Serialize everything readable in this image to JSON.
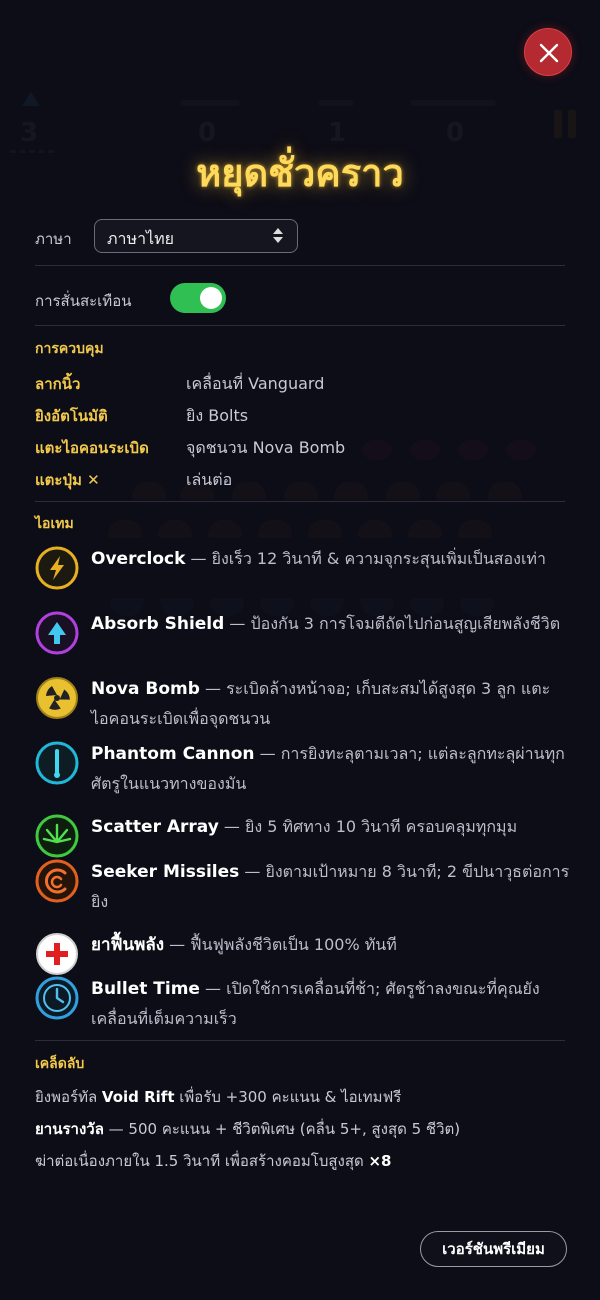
{
  "title": "หยุดชั่วคราว",
  "background_hud": {
    "lives": "3",
    "score_a": "0",
    "score_b": "1",
    "score_c": "0"
  },
  "settings": {
    "language_label": "ภาษา",
    "language_value": "ภาษาไทย",
    "vibration_label": "การสั่นสะเทือน",
    "vibration_on": true
  },
  "controls": {
    "heading": "การควบคุม",
    "rows": [
      {
        "key": "ลากนิ้ว",
        "value": "เคลื่อนที่ Vanguard"
      },
      {
        "key": "ยิงอัตโนมัติ",
        "value": "ยิง Bolts"
      },
      {
        "key": "แตะไอคอนระเบิด",
        "value": "จุดชนวน Nova Bomb"
      },
      {
        "key": "แตะปุ่ม ✕",
        "value": "เล่นต่อ"
      }
    ]
  },
  "items": {
    "heading": "ไอเทม",
    "list": [
      {
        "name": "Overclock",
        "desc": " — ยิงเร็ว 12 วินาที & ความจุกระสุนเพิ่มเป็นสองเท่า",
        "icon": "lightning-icon",
        "color": "#e8b020"
      },
      {
        "name": "Absorb Shield",
        "desc": " — ป้องกัน 3 การโจมตีถัดไปก่อนสูญเสียพลังชีวิต",
        "icon": "shield-arrow-icon",
        "color": "#b040e0"
      },
      {
        "name": "Nova Bomb",
        "desc": " — ระเบิดล้างหน้าจอ; เก็บสะสมได้สูงสุด 3 ลูก แตะไอคอนระเบิดเพื่อจุดชนวน",
        "icon": "radiation-icon",
        "color": "#e8c030"
      },
      {
        "name": "Phantom Cannon",
        "desc": " — การยิงทะลุตามเวลา; แต่ละลูกทะลุผ่านทุกศัตรูในแนวทางของมัน",
        "icon": "beam-icon",
        "color": "#20b8d8"
      },
      {
        "name": "Scatter Array",
        "desc": " — ยิง 5 ทิศทาง 10 วินาที ครอบคลุมทุกมุม",
        "icon": "spread-icon",
        "color": "#40c840"
      },
      {
        "name": "Seeker Missiles",
        "desc": " — ยิงตามเป้าหมาย 8 วินาที; 2 ขีปนาวุธต่อการยิง",
        "icon": "homing-icon",
        "color": "#e06020"
      },
      {
        "name": "ยาฟื้นพลัง",
        "desc": " — ฟื้นฟูพลังชีวิตเป็น 100% ทันที",
        "icon": "health-cross-icon",
        "color": "#e02020"
      },
      {
        "name": "Bullet Time",
        "desc": " — เปิดใช้การเคลื่อนที่ช้า; ศัตรูช้าลงขณะที่คุณยังเคลื่อนที่เต็มความเร็ว",
        "icon": "clock-icon",
        "color": "#30a0e0"
      }
    ]
  },
  "tips": {
    "heading": "เคล็ดลับ",
    "line1_pre": "ยิงพอร์ทัล ",
    "line1_bold": "Void Rift",
    "line1_post": " เพื่อรับ +300 คะแนน & ไอเทมฟรี",
    "line2_bold": "ยานรางวัล",
    "line2_post": " — 500 คะแนน + ชีวิตพิเศษ (คลื่น 5+, สูงสุด 5 ชีวิต)",
    "line3_pre": "ฆ่าต่อเนื่องภายใน 1.5 วินาที เพื่อสร้างคอมโบสูงสุด ",
    "line3_bold": "×8"
  },
  "premium_label": "เวอร์ชันพรีเมียม"
}
